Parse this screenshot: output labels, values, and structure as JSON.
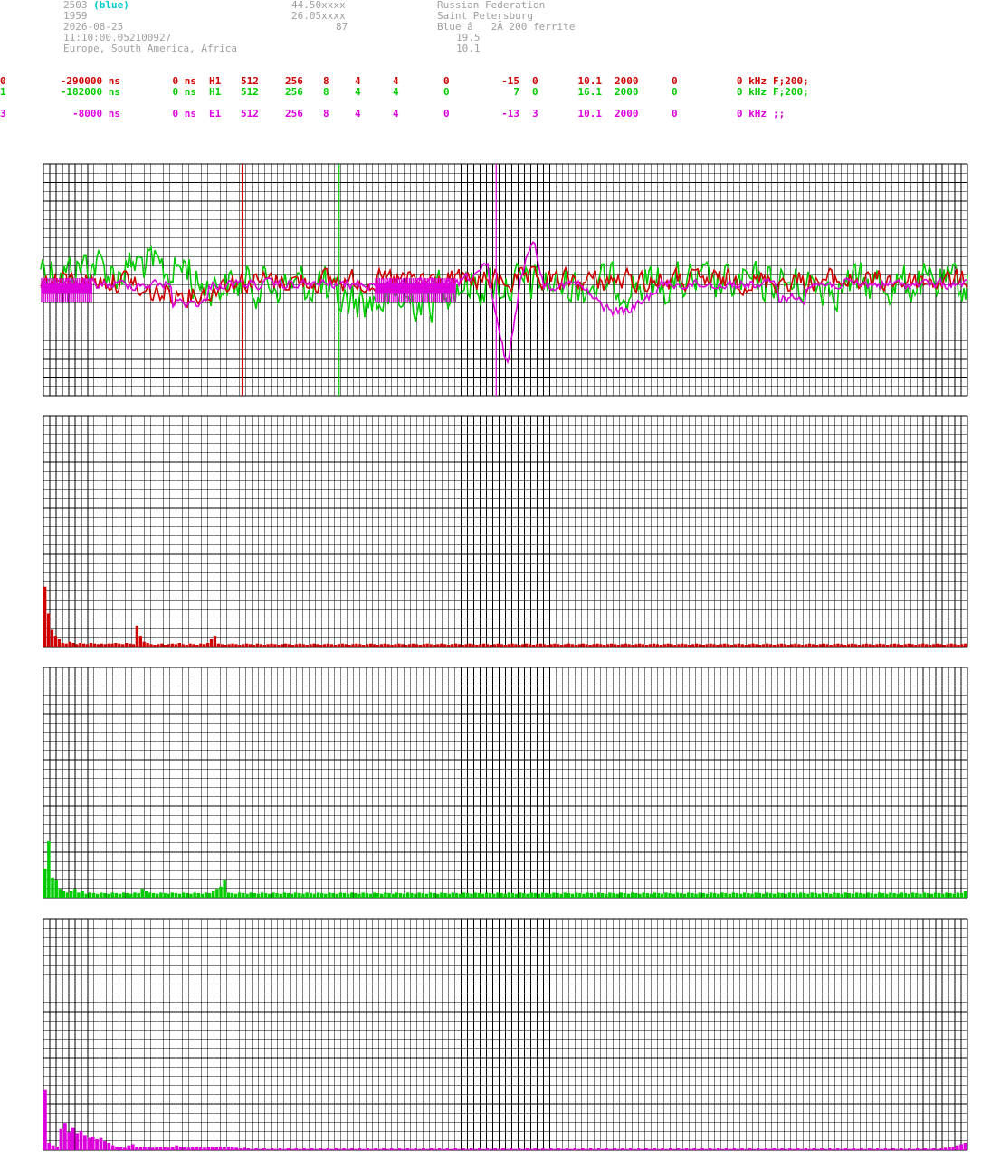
{
  "header": {
    "station_id": "2503",
    "station_color": "(blue)",
    "number": "1959",
    "date": "2026-08-25",
    "time": "11:10:00.052100927",
    "regions": "Europe, South America, Africa",
    "lat": "44.50xxxx",
    "lon": "26.05xxxx",
    "alt": "87",
    "country": "Russian Federation",
    "city": "Saint Petersburg",
    "antenna": "Blue â   2Ã 200 ferrite",
    "val1": "19.5",
    "val2": "10.1"
  },
  "channels": [
    {
      "idx": "0",
      "offset": "-290000 ns",
      "delay": "0 ns",
      "type": "H1",
      "c1": "512",
      "c2": "256",
      "c3": "8",
      "c4": "4",
      "c5": "4",
      "c6": "0",
      "c7": "-15",
      "c8": "0",
      "c9": "10.1",
      "c10": "2000",
      "c11": "0",
      "c12": "0 kHz",
      "c13": "F;200;",
      "color": "#d00000"
    },
    {
      "idx": "1",
      "offset": "-182000 ns",
      "delay": "0 ns",
      "type": "H1",
      "c1": "512",
      "c2": "256",
      "c3": "8",
      "c4": "4",
      "c5": "4",
      "c6": "0",
      "c7": "7",
      "c8": "0",
      "c9": "16.1",
      "c10": "2000",
      "c11": "0",
      "c12": "0 kHz",
      "c13": "F;200;",
      "color": "#00cc00"
    },
    {
      "idx": "3",
      "offset": "-8000 ns",
      "delay": "0 ns",
      "type": "E1",
      "c1": "512",
      "c2": "256",
      "c3": "8",
      "c4": "4",
      "c5": "4",
      "c6": "0",
      "c7": "-13",
      "c8": "3",
      "c9": "10.1",
      "c10": "2000",
      "c11": "0",
      "c12": "0 kHz",
      "c13": ";;",
      "color": "#dd00dd"
    }
  ],
  "colors": {
    "ch0": "#d00000",
    "ch1": "#00cc00",
    "ch3": "#dd00dd",
    "grid": "#000000"
  },
  "waveform": {
    "markers": [
      {
        "channel": "ch0",
        "t": 0.215
      },
      {
        "channel": "ch1",
        "t": 0.32
      },
      {
        "channel": "ch3",
        "t": 0.49
      }
    ]
  },
  "spectra": [
    {
      "channel": "ch0",
      "bins": [
        1.0,
        0.55,
        0.28,
        0.18,
        0.12,
        0.06,
        0.05,
        0.08,
        0.06,
        0.04,
        0.06,
        0.05,
        0.04,
        0.06,
        0.05,
        0.04,
        0.05,
        0.04,
        0.05,
        0.05,
        0.06,
        0.05,
        0.04,
        0.06,
        0.05,
        0.04,
        0.35,
        0.18,
        0.08,
        0.06,
        0.04,
        0.03,
        0.04,
        0.05,
        0.03,
        0.04,
        0.05,
        0.04,
        0.06,
        0.04,
        0.03,
        0.05,
        0.04,
        0.03,
        0.05,
        0.04,
        0.06,
        0.12,
        0.18,
        0.05,
        0.04,
        0.03,
        0.04,
        0.05,
        0.04,
        0.03,
        0.04,
        0.05,
        0.04,
        0.03,
        0.05,
        0.04,
        0.03,
        0.04,
        0.05,
        0.04,
        0.03,
        0.04,
        0.05,
        0.04,
        0.03,
        0.04,
        0.05,
        0.04,
        0.03,
        0.04,
        0.05,
        0.04,
        0.03,
        0.04,
        0.05,
        0.04,
        0.03,
        0.04,
        0.05,
        0.04,
        0.03,
        0.04,
        0.05,
        0.04,
        0.03,
        0.04,
        0.05,
        0.04,
        0.03,
        0.04,
        0.05,
        0.04,
        0.03,
        0.04,
        0.05,
        0.04,
        0.03,
        0.04,
        0.05,
        0.04,
        0.03,
        0.04,
        0.05,
        0.04,
        0.03,
        0.04,
        0.05,
        0.04,
        0.03,
        0.04,
        0.05,
        0.04,
        0.03,
        0.04,
        0.05,
        0.04,
        0.03,
        0.04,
        0.05,
        0.04,
        0.03,
        0.04,
        0.05,
        0.04,
        0.03,
        0.04,
        0.05,
        0.04,
        0.03,
        0.04,
        0.05,
        0.04,
        0.03,
        0.04,
        0.05,
        0.04,
        0.03,
        0.04,
        0.05,
        0.04,
        0.03,
        0.04,
        0.05,
        0.04,
        0.03,
        0.04,
        0.05,
        0.04,
        0.03,
        0.04,
        0.05,
        0.04,
        0.03,
        0.04,
        0.05,
        0.04,
        0.03,
        0.04,
        0.05,
        0.04,
        0.03,
        0.04,
        0.05,
        0.04,
        0.03,
        0.04,
        0.05,
        0.04,
        0.03,
        0.04,
        0.05,
        0.04,
        0.03,
        0.04,
        0.05,
        0.04,
        0.03,
        0.04,
        0.05,
        0.04,
        0.03,
        0.04,
        0.05,
        0.04,
        0.03,
        0.04,
        0.05,
        0.04,
        0.03,
        0.04,
        0.05,
        0.04,
        0.03,
        0.04,
        0.05,
        0.04,
        0.03,
        0.04,
        0.05,
        0.04,
        0.03,
        0.04,
        0.05,
        0.04,
        0.03,
        0.04,
        0.05,
        0.04,
        0.03,
        0.04,
        0.05,
        0.04,
        0.03,
        0.04,
        0.05,
        0.04,
        0.03,
        0.04,
        0.05,
        0.04,
        0.03,
        0.04,
        0.05,
        0.04,
        0.03,
        0.04,
        0.05,
        0.04,
        0.03,
        0.04,
        0.05,
        0.04,
        0.03,
        0.04,
        0.05,
        0.04,
        0.03,
        0.04,
        0.05,
        0.04,
        0.03,
        0.04,
        0.05,
        0.04,
        0.03,
        0.04,
        0.05,
        0.04,
        0.03,
        0.04,
        0.05,
        0.04,
        0.03,
        0.04,
        0.05
      ]
    },
    {
      "channel": "ch1",
      "bins": [
        0.5,
        0.95,
        0.35,
        0.3,
        0.15,
        0.12,
        0.1,
        0.12,
        0.15,
        0.1,
        0.12,
        0.08,
        0.1,
        0.09,
        0.08,
        0.1,
        0.09,
        0.08,
        0.1,
        0.09,
        0.08,
        0.1,
        0.09,
        0.08,
        0.1,
        0.09,
        0.15,
        0.12,
        0.1,
        0.09,
        0.08,
        0.1,
        0.09,
        0.08,
        0.1,
        0.09,
        0.08,
        0.1,
        0.09,
        0.08,
        0.1,
        0.09,
        0.08,
        0.1,
        0.09,
        0.12,
        0.15,
        0.2,
        0.3,
        0.1,
        0.09,
        0.08,
        0.1,
        0.09,
        0.08,
        0.1,
        0.09,
        0.08,
        0.1,
        0.09,
        0.08,
        0.1,
        0.09,
        0.08,
        0.1,
        0.09,
        0.08,
        0.1,
        0.09,
        0.08,
        0.1,
        0.09,
        0.08,
        0.1,
        0.09,
        0.08,
        0.1,
        0.09,
        0.08,
        0.1,
        0.09,
        0.08,
        0.1,
        0.09,
        0.08,
        0.1,
        0.09,
        0.08,
        0.1,
        0.09,
        0.08,
        0.1,
        0.09,
        0.08,
        0.1,
        0.09,
        0.08,
        0.1,
        0.09,
        0.08,
        0.1,
        0.09,
        0.08,
        0.1,
        0.09,
        0.08,
        0.1,
        0.09,
        0.08,
        0.1,
        0.09,
        0.08,
        0.1,
        0.09,
        0.08,
        0.1,
        0.09,
        0.08,
        0.1,
        0.09,
        0.08,
        0.1,
        0.09,
        0.08,
        0.1,
        0.09,
        0.08,
        0.1,
        0.09,
        0.08,
        0.1,
        0.09,
        0.08,
        0.1,
        0.09,
        0.08,
        0.1,
        0.09,
        0.08,
        0.1,
        0.09,
        0.08,
        0.1,
        0.09,
        0.08,
        0.1,
        0.09,
        0.08,
        0.1,
        0.09,
        0.08,
        0.1,
        0.09,
        0.08,
        0.1,
        0.09,
        0.08,
        0.1,
        0.09,
        0.08,
        0.1,
        0.09,
        0.08,
        0.1,
        0.09,
        0.08,
        0.1,
        0.09,
        0.08,
        0.1,
        0.09,
        0.08,
        0.1,
        0.09,
        0.08,
        0.1,
        0.09,
        0.08,
        0.1,
        0.09,
        0.08,
        0.1,
        0.09,
        0.08,
        0.1,
        0.09,
        0.08,
        0.1,
        0.09,
        0.08,
        0.1,
        0.09,
        0.08,
        0.1,
        0.09,
        0.08,
        0.1,
        0.09,
        0.08,
        0.1,
        0.09,
        0.08,
        0.1,
        0.09,
        0.08,
        0.1,
        0.09,
        0.08,
        0.1,
        0.09,
        0.08,
        0.1,
        0.09,
        0.08,
        0.1,
        0.09,
        0.08,
        0.1,
        0.09,
        0.08,
        0.1,
        0.09,
        0.08,
        0.1,
        0.09,
        0.08,
        0.1,
        0.09,
        0.08,
        0.1,
        0.09,
        0.08,
        0.1,
        0.09,
        0.08,
        0.1,
        0.09,
        0.08,
        0.1,
        0.09,
        0.08,
        0.1,
        0.09,
        0.08,
        0.1,
        0.09,
        0.12
      ]
    },
    {
      "channel": "ch3",
      "bins": [
        1.0,
        0.12,
        0.08,
        0.06,
        0.35,
        0.45,
        0.3,
        0.38,
        0.28,
        0.32,
        0.25,
        0.2,
        0.22,
        0.18,
        0.2,
        0.15,
        0.12,
        0.08,
        0.06,
        0.05,
        0.04,
        0.08,
        0.1,
        0.06,
        0.05,
        0.06,
        0.05,
        0.04,
        0.05,
        0.06,
        0.05,
        0.04,
        0.05,
        0.08,
        0.06,
        0.05,
        0.04,
        0.05,
        0.06,
        0.05,
        0.04,
        0.05,
        0.06,
        0.05,
        0.06,
        0.05,
        0.06,
        0.05,
        0.04,
        0.03,
        0.04,
        0.03,
        0.02,
        0.03,
        0.02,
        0.03,
        0.02,
        0.03,
        0.02,
        0.03,
        0.02,
        0.03,
        0.02,
        0.03,
        0.02,
        0.03,
        0.02,
        0.03,
        0.02,
        0.03,
        0.02,
        0.03,
        0.02,
        0.03,
        0.02,
        0.03,
        0.02,
        0.03,
        0.02,
        0.03,
        0.02,
        0.03,
        0.02,
        0.03,
        0.02,
        0.03,
        0.02,
        0.03,
        0.02,
        0.03,
        0.02,
        0.03,
        0.02,
        0.03,
        0.02,
        0.03,
        0.02,
        0.03,
        0.02,
        0.03,
        0.02,
        0.03,
        0.02,
        0.03,
        0.02,
        0.03,
        0.02,
        0.03,
        0.02,
        0.03,
        0.02,
        0.03,
        0.02,
        0.03,
        0.02,
        0.03,
        0.02,
        0.03,
        0.02,
        0.03,
        0.02,
        0.03,
        0.02,
        0.03,
        0.02,
        0.03,
        0.02,
        0.03,
        0.02,
        0.03,
        0.02,
        0.03,
        0.02,
        0.03,
        0.02,
        0.03,
        0.02,
        0.03,
        0.02,
        0.03,
        0.02,
        0.03,
        0.02,
        0.03,
        0.02,
        0.03,
        0.02,
        0.03,
        0.02,
        0.03,
        0.02,
        0.03,
        0.02,
        0.03,
        0.02,
        0.03,
        0.02,
        0.03,
        0.02,
        0.03,
        0.02,
        0.03,
        0.02,
        0.03,
        0.02,
        0.03,
        0.02,
        0.03,
        0.02,
        0.03,
        0.02,
        0.03,
        0.02,
        0.03,
        0.02,
        0.03,
        0.02,
        0.03,
        0.02,
        0.03,
        0.02,
        0.03,
        0.02,
        0.03,
        0.02,
        0.03,
        0.02,
        0.03,
        0.02,
        0.03,
        0.02,
        0.03,
        0.02,
        0.03,
        0.02,
        0.03,
        0.02,
        0.03,
        0.02,
        0.03,
        0.02,
        0.03,
        0.02,
        0.03,
        0.02,
        0.03,
        0.02,
        0.03,
        0.02,
        0.03,
        0.02,
        0.03,
        0.02,
        0.03,
        0.02,
        0.03,
        0.02,
        0.03,
        0.02,
        0.03,
        0.02,
        0.03,
        0.02,
        0.03,
        0.02,
        0.03,
        0.04,
        0.05,
        0.06,
        0.08,
        0.1,
        0.12
      ]
    }
  ]
}
